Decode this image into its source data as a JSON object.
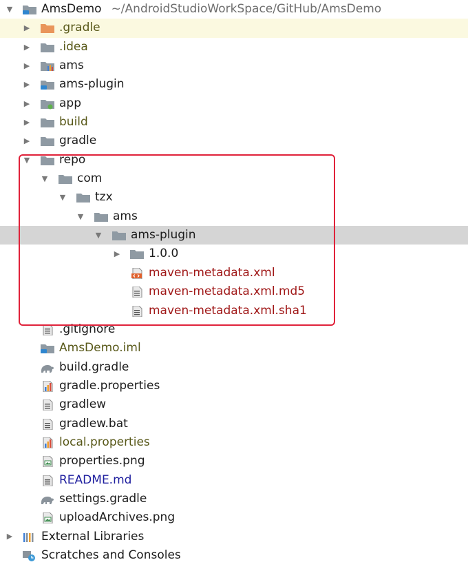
{
  "root": {
    "name": "AmsDemo",
    "path": "~/AndroidStudioWorkSpace/GitHub/AmsDemo"
  },
  "items": [
    {
      "label": ".gradle"
    },
    {
      "label": ".idea"
    },
    {
      "label": "ams"
    },
    {
      "label": "ams-plugin"
    },
    {
      "label": "app"
    },
    {
      "label": "build"
    },
    {
      "label": "gradle"
    },
    {
      "label": "repo"
    },
    {
      "label": "com"
    },
    {
      "label": "tzx"
    },
    {
      "label": "ams"
    },
    {
      "label": "ams-plugin"
    },
    {
      "label": "1.0.0"
    },
    {
      "label": "maven-metadata.xml"
    },
    {
      "label": "maven-metadata.xml.md5"
    },
    {
      "label": "maven-metadata.xml.sha1"
    },
    {
      "label": ".gitignore"
    },
    {
      "label": "AmsDemo.iml"
    },
    {
      "label": "build.gradle"
    },
    {
      "label": "gradle.properties"
    },
    {
      "label": "gradlew"
    },
    {
      "label": "gradlew.bat"
    },
    {
      "label": "local.properties"
    },
    {
      "label": "properties.png"
    },
    {
      "label": "README.md"
    },
    {
      "label": "settings.gradle"
    },
    {
      "label": "uploadArchives.png"
    },
    {
      "label": "External Libraries"
    },
    {
      "label": "Scratches and Consoles"
    }
  ],
  "colors": {
    "selected_row": "#d5d5d5",
    "highlight_row": "#fbf9e0",
    "annotation_box": "#e0223a",
    "untracked_text": "#59591a",
    "unversioned_text": "#a01818",
    "modified_text": "#1d1d9e"
  }
}
